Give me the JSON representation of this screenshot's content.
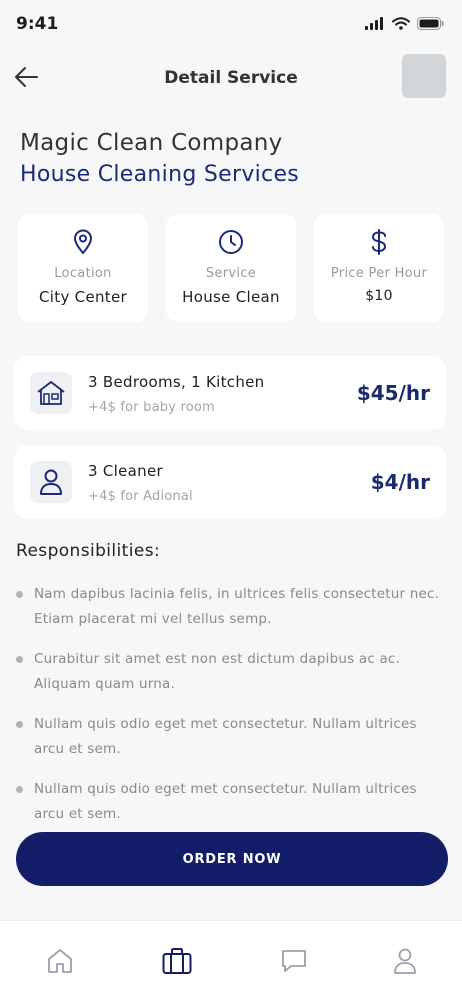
{
  "status": {
    "time": "9:41"
  },
  "header": {
    "title": "Detail Service"
  },
  "company": {
    "name": "Magic Clean Company",
    "service": "House Cleaning Services"
  },
  "info_cards": [
    {
      "icon": "location-pin-icon",
      "label": "Location",
      "value": "City Center"
    },
    {
      "icon": "clock-icon",
      "label": "Service",
      "value": "House Clean"
    },
    {
      "icon": "dollar-icon",
      "label": "Price Per Hour",
      "value": "$10"
    }
  ],
  "options": [
    {
      "icon": "house-icon",
      "title": "3 Bedrooms, 1 Kitchen",
      "subtitle": "+4$ for baby room",
      "price": "$45/hr"
    },
    {
      "icon": "user-icon",
      "title": "3 Cleaner",
      "subtitle": "+4$ for Adional",
      "price": "$4/hr"
    }
  ],
  "responsibilities": {
    "title": "Responsibilities:",
    "items": [
      "Nam dapibus lacinia felis, in ultrices felis consectetur nec. Etiam placerat mi vel tellus semp.",
      " Curabitur sit amet est non est dictum dapibus ac ac. Aliquam quam urna.",
      "Nullam quis odio eget met consectetur. Nullam ultrices arcu et sem.",
      "Nullam quis odio eget met consectetur. Nullam ultrices arcu et sem."
    ]
  },
  "order_button": {
    "label": "ORDER NOW"
  },
  "bottom_nav": [
    {
      "icon": "home-icon",
      "active": false
    },
    {
      "icon": "briefcase-icon",
      "active": true
    },
    {
      "icon": "chat-icon",
      "active": false
    },
    {
      "icon": "profile-icon",
      "active": false
    }
  ],
  "colors": {
    "accent": "#131c66",
    "service_text": "#1a2a7a",
    "muted": "#9a9a9a"
  }
}
